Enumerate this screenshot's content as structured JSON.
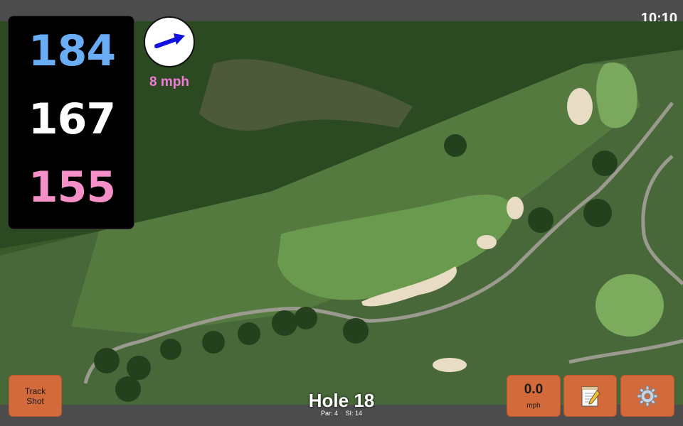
{
  "status": {
    "clock": "10:10"
  },
  "distances": {
    "back": "184",
    "middle": "167",
    "front": "155"
  },
  "wind": {
    "speed_label": "8 mph",
    "direction_icon": "arrow-icon"
  },
  "hole": {
    "title": "Hole 18",
    "par": "Par: 4",
    "stroke_index": "SI: 14"
  },
  "buttons": {
    "track_shot_line1": "Track",
    "track_shot_line2": "Shot",
    "speed_value": "0.0",
    "speed_unit": "mph",
    "notes_icon": "notepad-icon",
    "settings_icon": "gear-icon"
  },
  "colors": {
    "back_distance": "#69aef4",
    "middle_distance": "#ffffff",
    "front_distance": "#f48fc8",
    "wind_text": "#f07ad8",
    "button": "#d36a3b"
  }
}
